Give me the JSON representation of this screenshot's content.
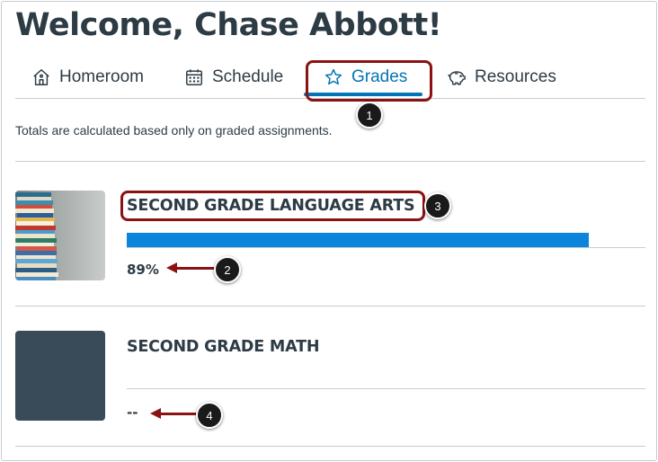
{
  "page": {
    "title": "Welcome, Chase Abbott!"
  },
  "tabs": [
    {
      "label": "Homeroom",
      "icon": "home-icon",
      "active": false
    },
    {
      "label": "Schedule",
      "icon": "calendar-icon",
      "active": false
    },
    {
      "label": "Grades",
      "icon": "star-icon",
      "active": true
    },
    {
      "label": "Resources",
      "icon": "piggy-bank-icon",
      "active": false
    }
  ],
  "grades_note": "Totals are calculated based only on graded assignments.",
  "courses": [
    {
      "title": "SECOND GRADE LANGUAGE ARTS",
      "grade": "89%",
      "progress_percent": 89,
      "image": "stacked-books"
    },
    {
      "title": "SECOND GRADE MATH",
      "grade": "--",
      "image": "solid-color-card"
    }
  ],
  "callouts": [
    "1",
    "2",
    "3",
    "4"
  ],
  "colors": {
    "accent": "#0374b5",
    "progress": "#0a84dc",
    "text": "#2d3b45",
    "callout": "#8b1212",
    "math_card": "#394b58"
  }
}
